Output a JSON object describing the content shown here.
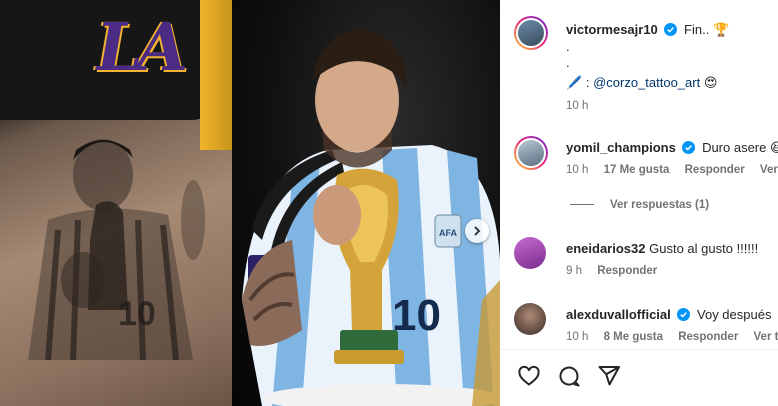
{
  "post": {
    "author": "victormesajr10",
    "caption_line1": "Fin..",
    "caption_dot1": ".",
    "caption_dot2": ".",
    "caption_credit_sep": ":",
    "caption_mention": "@corzo_tattoo_art",
    "time": "10 h",
    "emoji_trophy": "🏆",
    "emoji_pen": "🖊️",
    "emoji_heart_eyes": "😍"
  },
  "comments": [
    {
      "user": "yomil_champions",
      "verified": true,
      "text": "Duro asere",
      "emoji": "😆",
      "time": "10 h",
      "likes": "17 Me gusta",
      "reply": "Responder",
      "translate": "Ver tra",
      "view_replies": "Ver respuestas (1)"
    },
    {
      "user": "eneidarios32",
      "verified": false,
      "text": "Gusto al gusto !!!!!!",
      "time": "9 h",
      "reply": "Responder"
    },
    {
      "user": "alexduvallofficial",
      "verified": true,
      "text": "Voy después",
      "time": "10 h",
      "likes": "8 Me gusta",
      "reply": "Responder",
      "translate": "Ver tr"
    }
  ],
  "media": {
    "jersey_text": "LA",
    "player_number": "10",
    "badge_text": "AFA"
  },
  "colors": {
    "verified_blue": "#0095f6",
    "link": "#00376b",
    "lakers_purple": "#4b2b84",
    "lakers_gold": "#f3b230"
  },
  "icons": [
    "heart-icon",
    "comment-icon",
    "share-icon",
    "verified-icon",
    "chevron-right-icon"
  ]
}
